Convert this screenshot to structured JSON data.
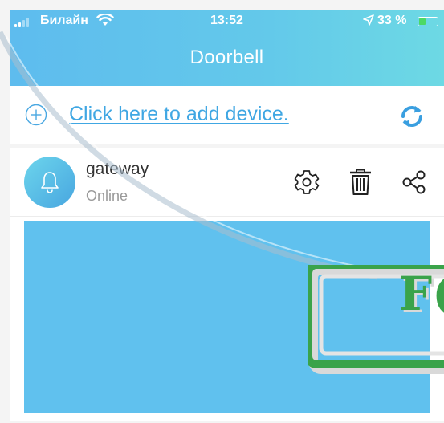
{
  "status_bar": {
    "carrier": "Билайн",
    "time": "13:52",
    "battery": "33 %"
  },
  "nav": {
    "title": "Doorbell"
  },
  "add_device": {
    "link_text": "Click here to add device."
  },
  "device": {
    "name": "gateway",
    "status": "Online"
  },
  "watermark": {
    "text": "F("
  },
  "colors": {
    "header": "#5ebcee",
    "accent": "#40a7e3",
    "preview": "#60c1ee",
    "stamp": "#3aa34a"
  },
  "icons": {
    "status": [
      "signal-icon",
      "wifi-icon",
      "location-arrow-icon",
      "battery-charging-icon"
    ],
    "add": "plus-circle-icon",
    "refresh": "refresh-icon",
    "device": "bell-icon",
    "actions": [
      "gear-icon",
      "trash-icon",
      "share-icon"
    ]
  }
}
